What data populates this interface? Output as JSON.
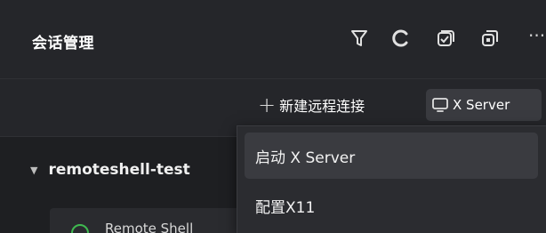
{
  "header": {
    "title": "会话管理",
    "icons": [
      "filter-icon",
      "refresh-icon",
      "checklist-icon",
      "copy-icon"
    ],
    "more_label": "···"
  },
  "toolbar": {
    "new_remote_label": "新建远程连接",
    "xserver_label": "X Server"
  },
  "tree": {
    "group_label": "remoteshell-test",
    "child_label": "Remote Shell"
  },
  "menu": {
    "items": [
      {
        "label": "启动 X Server"
      },
      {
        "label": "配置X11"
      }
    ]
  }
}
